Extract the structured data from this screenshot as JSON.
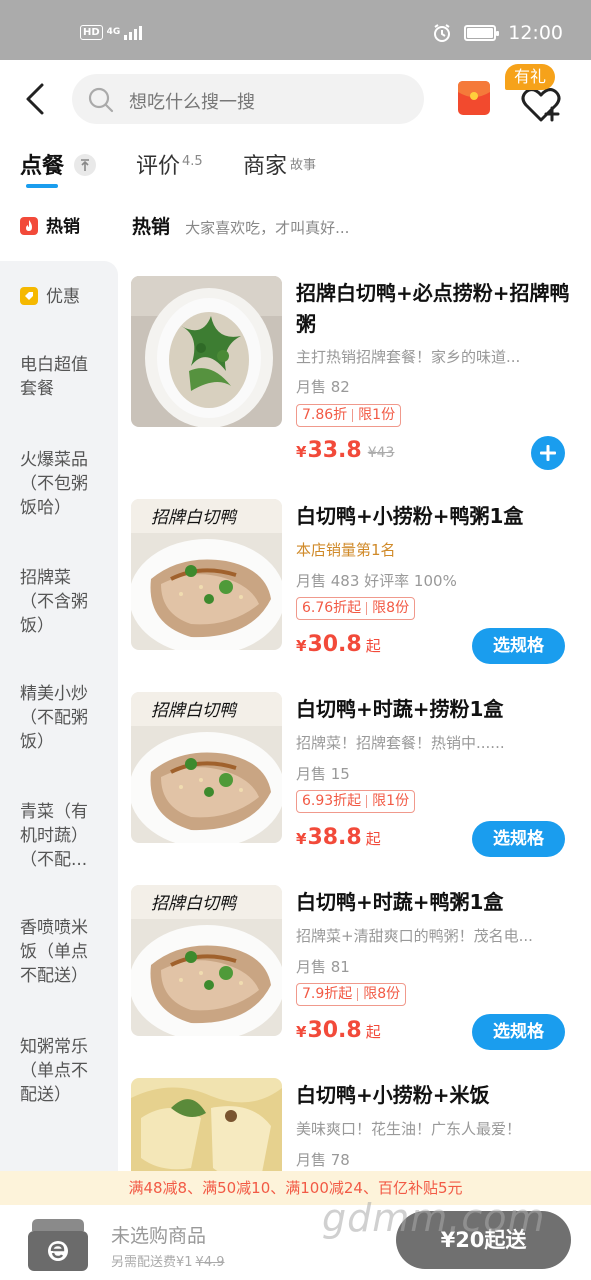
{
  "status_bar": {
    "hd": "HD",
    "network": "4G",
    "time": "12:00"
  },
  "header": {
    "search_placeholder": "想吃什么搜一搜",
    "gift_badge": "有礼"
  },
  "tabs": [
    {
      "label": "点餐"
    },
    {
      "label": "评价",
      "sub": "4.5"
    },
    {
      "label": "商家",
      "sub": "故事"
    }
  ],
  "sidebar": {
    "items": [
      {
        "label": "热销"
      },
      {
        "label": "优惠"
      },
      {
        "label": "电白超值套餐"
      },
      {
        "label": "火爆菜品（不包粥饭哈）"
      },
      {
        "label": "招牌菜（不含粥饭）"
      },
      {
        "label": "精美小炒（不配粥饭）"
      },
      {
        "label": "青菜（有机时蔬）（不配..."
      },
      {
        "label": "香喷喷米饭（单点不配送）"
      },
      {
        "label": "知粥常乐（单点不配送）"
      }
    ]
  },
  "section": {
    "title": "热销",
    "desc": "大家喜欢吃，才叫真好..."
  },
  "items": [
    {
      "name": "招牌白切鸭+必点捞粉+招牌鸭粥",
      "desc": "主打热销招牌套餐！家乡的味道...",
      "sales": "月售 82",
      "discount": "7.86折",
      "limit": "限1份",
      "currency": "¥",
      "price": "33.8",
      "orig_price": "¥43"
    },
    {
      "name": "白切鸭+小捞粉+鸭粥1盒",
      "rank": "本店销量第1名",
      "sales": "月售 483 好评率 100%",
      "discount": "6.76折起",
      "limit": "限8份",
      "currency": "¥",
      "price": "30.8",
      "price_suffix": "起",
      "button": "选规格",
      "photo_caption": "招牌白切鸭"
    },
    {
      "name": "白切鸭+时蔬+捞粉1盒",
      "desc": "招牌菜！招牌套餐！热销中......",
      "sales": "月售 15",
      "discount": "6.93折起",
      "limit": "限1份",
      "currency": "¥",
      "price": "38.8",
      "price_suffix": "起",
      "button": "选规格",
      "photo_caption": "招牌白切鸭"
    },
    {
      "name": "白切鸭+时蔬+鸭粥1盒",
      "desc": "招牌菜+清甜爽口的鸭粥！茂名电...",
      "sales": "月售 81",
      "discount": "7.9折起",
      "limit": "限8份",
      "currency": "¥",
      "price": "30.8",
      "price_suffix": "起",
      "button": "选规格",
      "photo_caption": "招牌白切鸭"
    },
    {
      "name": "白切鸭+小捞粉+米饭",
      "desc": "美味爽口！花生油！广东人最爱！",
      "sales": "月售 78"
    }
  ],
  "promo": "满48减8、满50减10、满100减24、百亿补贴5元",
  "cart": {
    "title": "未选购商品",
    "fee_label": "另需配送费¥1",
    "fee_orig": "¥4.9",
    "checkout": "¥20起送"
  },
  "watermark": "gdmm.com",
  "colors": {
    "accent": "#1a9dee",
    "price": "#f24a3a",
    "promo_bg": "#fdf3da"
  }
}
